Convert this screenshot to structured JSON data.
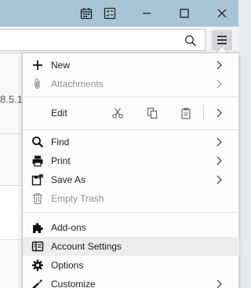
{
  "window": {
    "calendar_icon": "calendar-icon",
    "tasks_icon": "tasks-icon",
    "minimize_icon": "minimize-icon",
    "maximize_icon": "maximize-icon",
    "close_icon": "close-icon"
  },
  "toolbar": {
    "search_icon": "search-icon",
    "menu_icon": "hamburger-menu-icon"
  },
  "background": {
    "version_text": "8.5.1"
  },
  "menu": {
    "new": {
      "label": "New",
      "icon": "plus-icon"
    },
    "attachments": {
      "label": "Attachments",
      "icon": "paperclip-icon"
    },
    "edit": {
      "label": "Edit",
      "cut_icon": "scissors-icon",
      "copy_icon": "copy-icon",
      "paste_icon": "clipboard-icon"
    },
    "find": {
      "label": "Find",
      "icon": "magnifier-icon"
    },
    "print": {
      "label": "Print",
      "icon": "printer-icon"
    },
    "save_as": {
      "label": "Save As",
      "icon": "save-as-icon"
    },
    "empty_trash": {
      "label": "Empty Trash",
      "icon": "trash-icon"
    },
    "addons": {
      "label": "Add-ons",
      "icon": "puzzle-icon"
    },
    "account_settings": {
      "label": "Account Settings",
      "icon": "account-settings-icon"
    },
    "options": {
      "label": "Options",
      "icon": "gear-icon"
    },
    "customize": {
      "label": "Customize",
      "icon": "customize-icon"
    }
  },
  "colors": {
    "titlebar": "#a7c4d7",
    "menu_bg": "#fdfdfd",
    "highlight": "#ececee",
    "disabled_text": "#8f8f95"
  }
}
